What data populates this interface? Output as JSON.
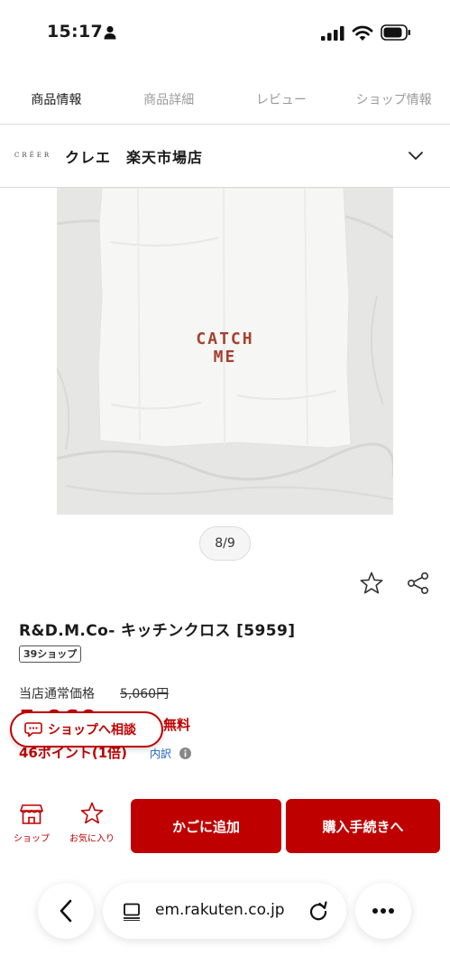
{
  "status_bar": {
    "time": "15:17"
  },
  "tabs": [
    {
      "label": "商品情報",
      "active": true
    },
    {
      "label": "商品詳細",
      "active": false
    },
    {
      "label": "レビュー",
      "active": false
    },
    {
      "label": "ショップ情報",
      "active": false
    }
  ],
  "shop": {
    "logo_text": "CRÉER",
    "name": "クレエ　楽天市場店"
  },
  "gallery": {
    "embroidery_line1": "CATCH",
    "embroidery_line2": "ME",
    "counter": "8/9"
  },
  "product": {
    "title": "R&D.M.Co- キッチンクロス [5959]",
    "badge": "39ショップ",
    "regular_price_label": "当店通常価格",
    "regular_price": "5,060円",
    "sale_price": "5,060",
    "shipping": "無料",
    "points": "46ポイント(1倍)",
    "breakdown": "内訳"
  },
  "consult": {
    "label": "ショップへ相談"
  },
  "actions": {
    "shop_label": "ショップ",
    "favorite_label": "お気に入り",
    "cart_label": "かごに追加",
    "checkout_label": "購入手続きへ"
  },
  "browser": {
    "url": "em.rakuten.co.jp"
  },
  "colors": {
    "accent": "#bf0000",
    "link": "#1f5fbf",
    "divider": "#d9d9d9"
  }
}
